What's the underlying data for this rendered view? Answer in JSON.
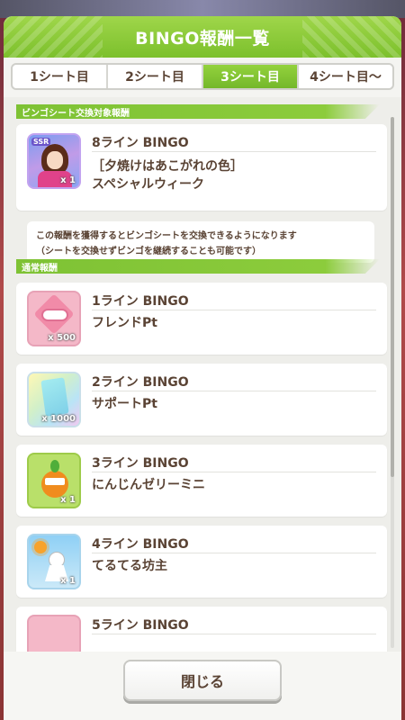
{
  "dialog": {
    "title": "BINGO報酬一覧"
  },
  "tabs": [
    {
      "label": "1シート目",
      "active": false
    },
    {
      "label": "2シート目",
      "active": false
    },
    {
      "label": "3シート目",
      "active": true
    },
    {
      "label": "4シート目〜",
      "active": false
    }
  ],
  "exchange_section": {
    "header": "ビンゴシート交換対象報酬",
    "reward": {
      "line": "8ライン BINGO",
      "title": "［夕焼けはあこがれの色］",
      "name": "スペシャルウィーク",
      "badge": "SSR",
      "qty": "x 1",
      "icon": "ssr-support-card-icon"
    },
    "note_line1": "この報酬を獲得するとビンゴシートを交換できるようになります",
    "note_line2": "（シートを交換せずビンゴを継続することも可能です）"
  },
  "normal_section": {
    "header": "通常報酬",
    "rewards": [
      {
        "line": "1ライン BINGO",
        "name": "フレンドPt",
        "qty": "x 500",
        "icon": "friend-pt-icon"
      },
      {
        "line": "2ライン BINGO",
        "name": "サポートPt",
        "qty": "x 1000",
        "icon": "support-pt-icon"
      },
      {
        "line": "3ライン BINGO",
        "name": "にんじんゼリーミニ",
        "qty": "x 1",
        "icon": "carrot-jelly-icon"
      },
      {
        "line": "4ライン BINGO",
        "name": "てるてる坊主",
        "qty": "x 1",
        "icon": "teru-teru-bozu-icon"
      },
      {
        "line": "5ライン BINGO",
        "name": "",
        "qty": "",
        "icon": "reward-icon"
      }
    ]
  },
  "footer": {
    "close_label": "閉じる"
  },
  "colors": {
    "accent_green": "#7cc02c",
    "text_brown": "#5a4334"
  }
}
